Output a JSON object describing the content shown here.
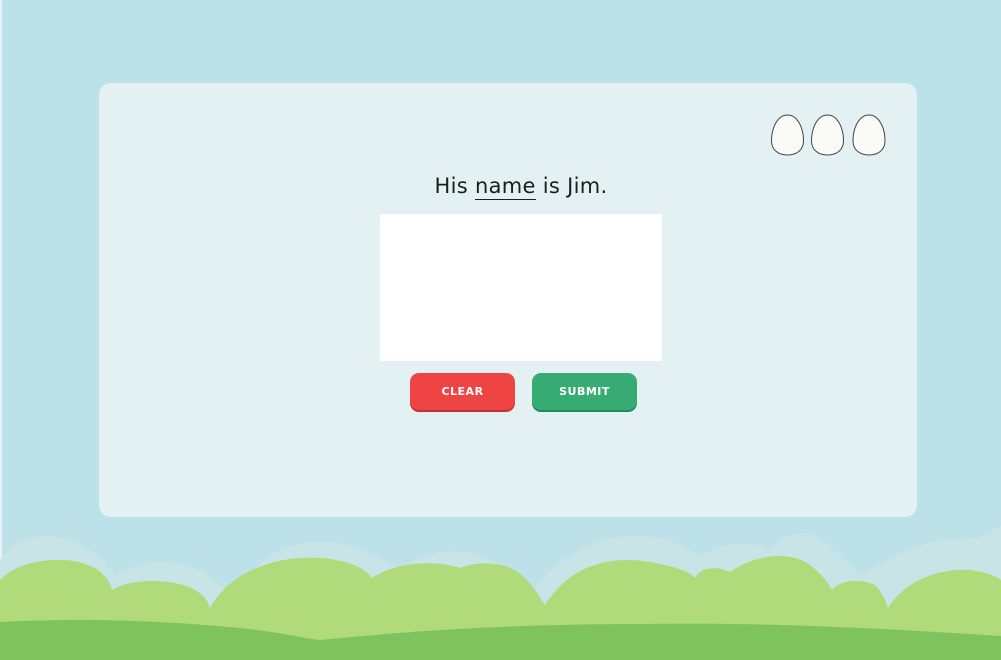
{
  "prompt": {
    "before": "His ",
    "target_word": "name",
    "after": " is Jim."
  },
  "buttons": {
    "clear_label": "CLEAR",
    "submit_label": "SUBMIT"
  },
  "lives": {
    "total": 3,
    "icon": "egg-icon"
  },
  "colors": {
    "sky": "#bce1e9",
    "card": "#e3f1f3",
    "clear": "#ef4444",
    "submit": "#36ac74",
    "grass_light": "#b1da7b",
    "grass_dark": "#7fc35c"
  }
}
